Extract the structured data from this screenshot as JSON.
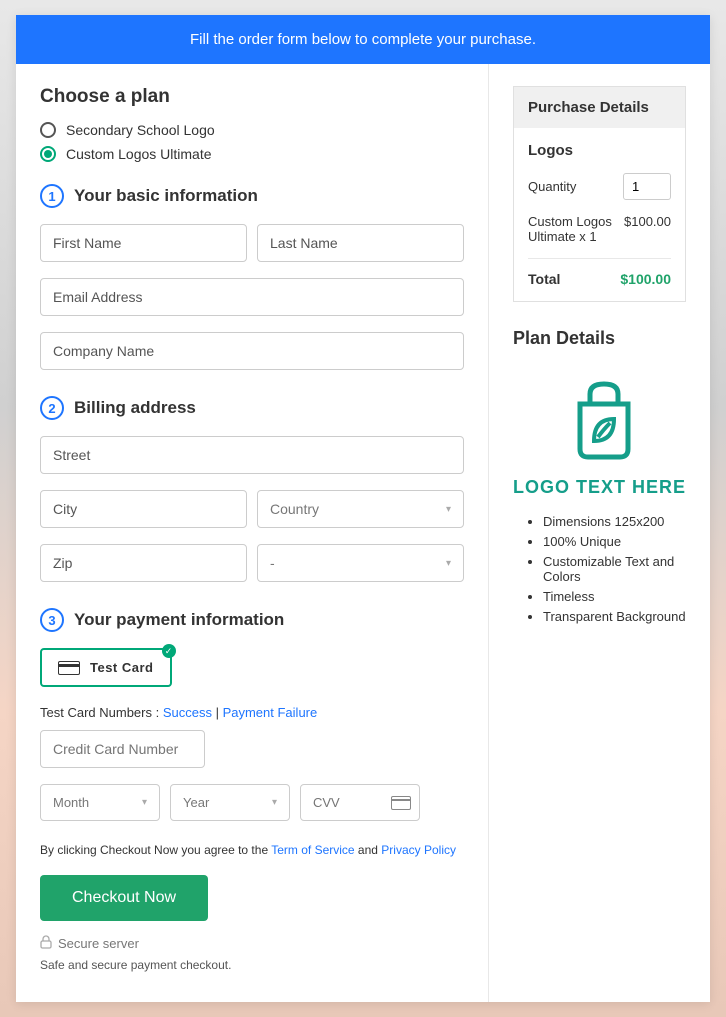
{
  "banner": "Fill the order form below to complete your purchase.",
  "plan": {
    "heading": "Choose a plan",
    "options": [
      "Secondary School Logo",
      "Custom Logos Ultimate"
    ]
  },
  "step1": {
    "title": "Your basic information",
    "first_name": "First Name",
    "last_name": "Last Name",
    "email": "Email Address",
    "company": "Company Name"
  },
  "step2": {
    "title": "Billing address",
    "street": "Street",
    "city": "City",
    "country": "Country",
    "zip": "Zip",
    "state": "-"
  },
  "step3": {
    "title": "Your payment information",
    "card_label": "Test Card",
    "test_prefix": "Test Card Numbers : ",
    "success": "Success",
    "sep": " | ",
    "failure": "Payment Failure",
    "cc_placeholder": "Credit Card Number",
    "month": "Month",
    "year": "Year",
    "cvv": "CVV"
  },
  "terms": {
    "prefix": "By clicking Checkout Now you agree to the ",
    "tos": "Term of Service",
    "and": " and ",
    "privacy": "Privacy Policy"
  },
  "checkout": "Checkout Now",
  "secure": "Secure server",
  "safe": "Safe and secure payment checkout.",
  "purchase": {
    "head": "Purchase Details",
    "title": "Logos",
    "qty_label": "Quantity",
    "qty_value": "1",
    "item_name": "Custom Logos Ultimate x 1",
    "item_price": "$100.00",
    "total_label": "Total",
    "total_value": "$100.00"
  },
  "details": {
    "title": "Plan Details",
    "logo_text": "LOGO TEXT HERE",
    "features": [
      "Dimensions 125x200",
      "100% Unique",
      "Customizable Text and Colors",
      "Timeless",
      "Transparent Background"
    ]
  }
}
